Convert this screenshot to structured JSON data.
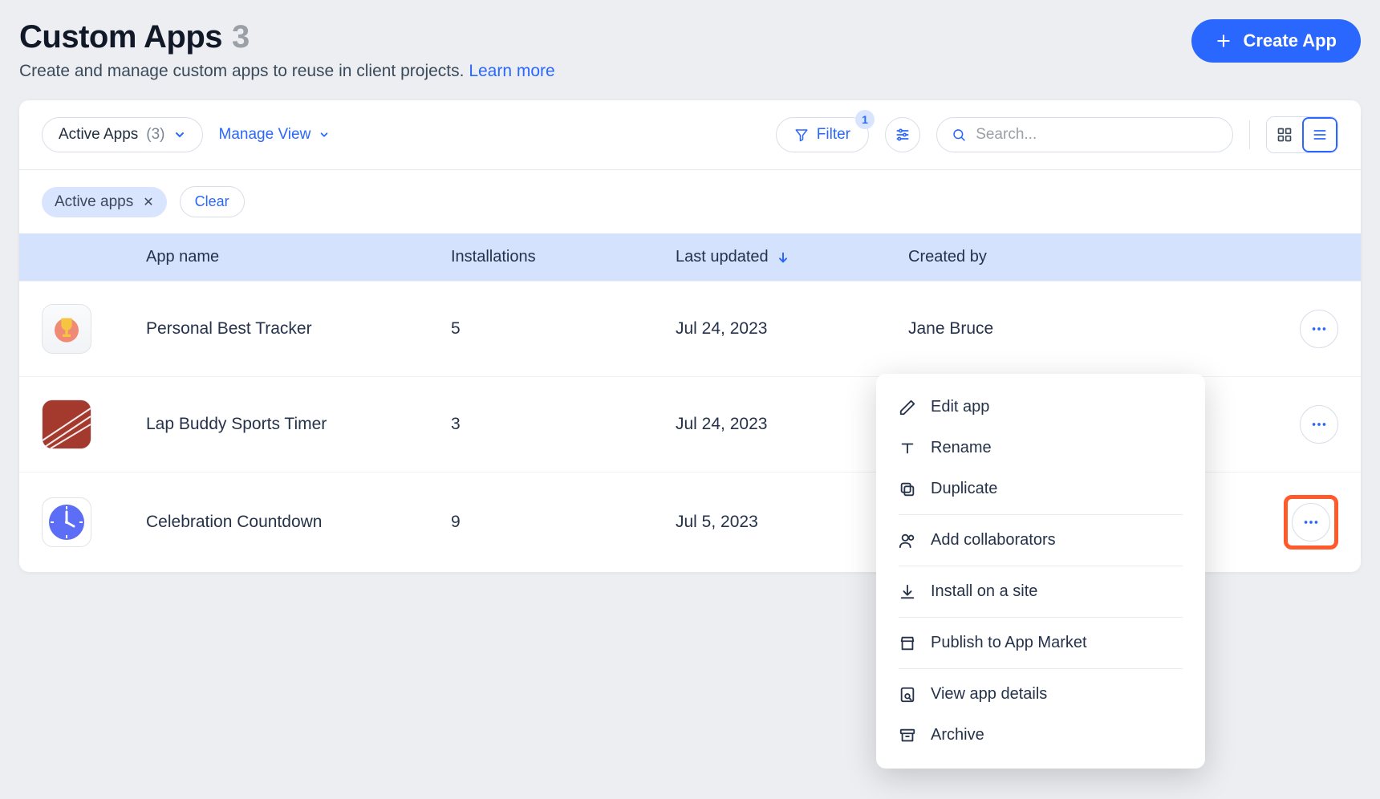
{
  "header": {
    "title": "Custom Apps",
    "count": "3",
    "subtitle_prefix": "Create and manage custom apps to reuse in client projects. ",
    "learn_more": "Learn more",
    "create_button": "Create App"
  },
  "toolbar": {
    "view_name": "Active Apps",
    "view_count": "(3)",
    "manage_view": "Manage View",
    "filter_label": "Filter",
    "filter_badge": "1",
    "search_placeholder": "Search..."
  },
  "chips": {
    "active_apps": "Active apps",
    "clear": "Clear"
  },
  "table": {
    "headers": {
      "app_name": "App name",
      "installations": "Installations",
      "last_updated": "Last updated",
      "created_by": "Created by"
    },
    "rows": [
      {
        "name": "Personal Best Tracker",
        "installations": "5",
        "last_updated": "Jul 24, 2023",
        "created_by": "Jane Bruce"
      },
      {
        "name": "Lap Buddy Sports Timer",
        "installations": "3",
        "last_updated": "Jul 24, 2023",
        "created_by": ""
      },
      {
        "name": "Celebration Countdown",
        "installations": "9",
        "last_updated": "Jul 5, 2023",
        "created_by": ""
      }
    ]
  },
  "menu": {
    "edit": "Edit app",
    "rename": "Rename",
    "duplicate": "Duplicate",
    "add_collaborators": "Add collaborators",
    "install": "Install on a site",
    "publish": "Publish to App Market",
    "details": "View app details",
    "archive": "Archive"
  }
}
